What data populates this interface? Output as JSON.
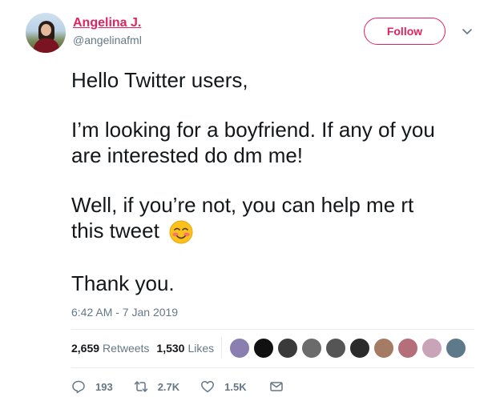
{
  "author": {
    "name": "Angelina J.",
    "handle": "@angelinafml",
    "avatar_icon": "avatar-photo"
  },
  "follow_button": {
    "label": "Follow",
    "color": "#e0245e"
  },
  "menu_icon": "chevron-down-icon",
  "tweet": {
    "lines": [
      "Hello Twitter users,",
      "I’m looking for a boyfriend. If any of you",
      "are interested do dm me!",
      "Well, if you’re not, you can help me rt",
      "this tweet",
      "Thank you."
    ],
    "emoji": "smiling-blushing-face"
  },
  "timestamp": "6:42 AM - 7 Jan 2019",
  "stats": {
    "retweets_count": "2,659",
    "retweets_label": "Retweets",
    "likes_count": "1,530",
    "likes_label": "Likes"
  },
  "likers_colors": [
    "#8a7fb0",
    "#111111",
    "#3a3a3a",
    "#6b6b6b",
    "#555555",
    "#2b2b2b",
    "#a57b63",
    "#b56f7a",
    "#c9a3b8",
    "#5e7a8a"
  ],
  "actions": {
    "reply_count": "193",
    "retweet_count": "2.7K",
    "like_count": "1.5K"
  },
  "colors": {
    "accent": "#e0245e",
    "secondary_text": "#657786",
    "primary_text": "#14171a"
  }
}
